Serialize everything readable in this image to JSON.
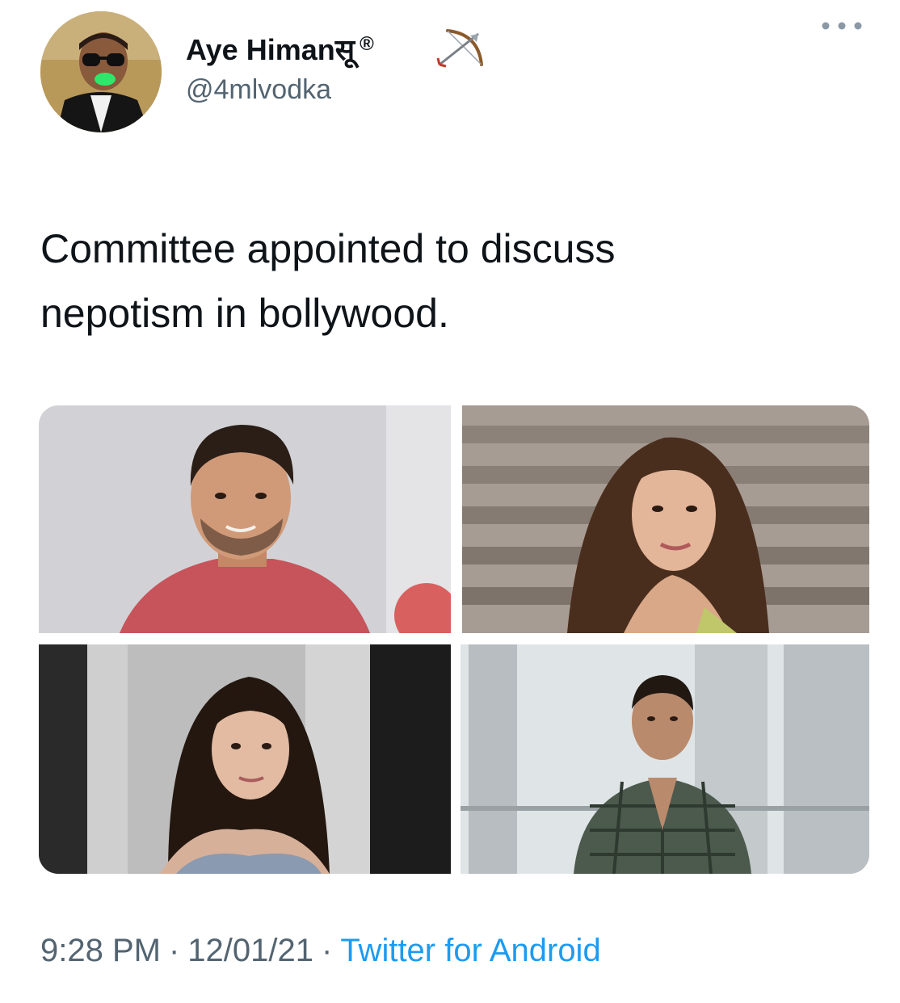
{
  "tweet": {
    "author": {
      "display_name": "Aye Himanसू",
      "registered_mark": "®",
      "handle": "@4mlvodka",
      "avatar_icon": "avatar-photo",
      "badge_icon": "bow-and-arrow-icon"
    },
    "text_lines": [
      "Committee appointed to discuss",
      "nepotism in bollywood."
    ],
    "media": [
      {
        "name": "photo-man-red-shirt"
      },
      {
        "name": "photo-woman-long-hair"
      },
      {
        "name": "photo-young-woman"
      },
      {
        "name": "photo-man-checked-shirt"
      }
    ],
    "meta": {
      "time": "9:28 PM",
      "separator": "·",
      "date": "12/01/21",
      "source": "Twitter for Android"
    }
  },
  "colors": {
    "text": "#0f1419",
    "secondary": "#536471",
    "link": "#1d9bf0",
    "background": "#ffffff"
  }
}
